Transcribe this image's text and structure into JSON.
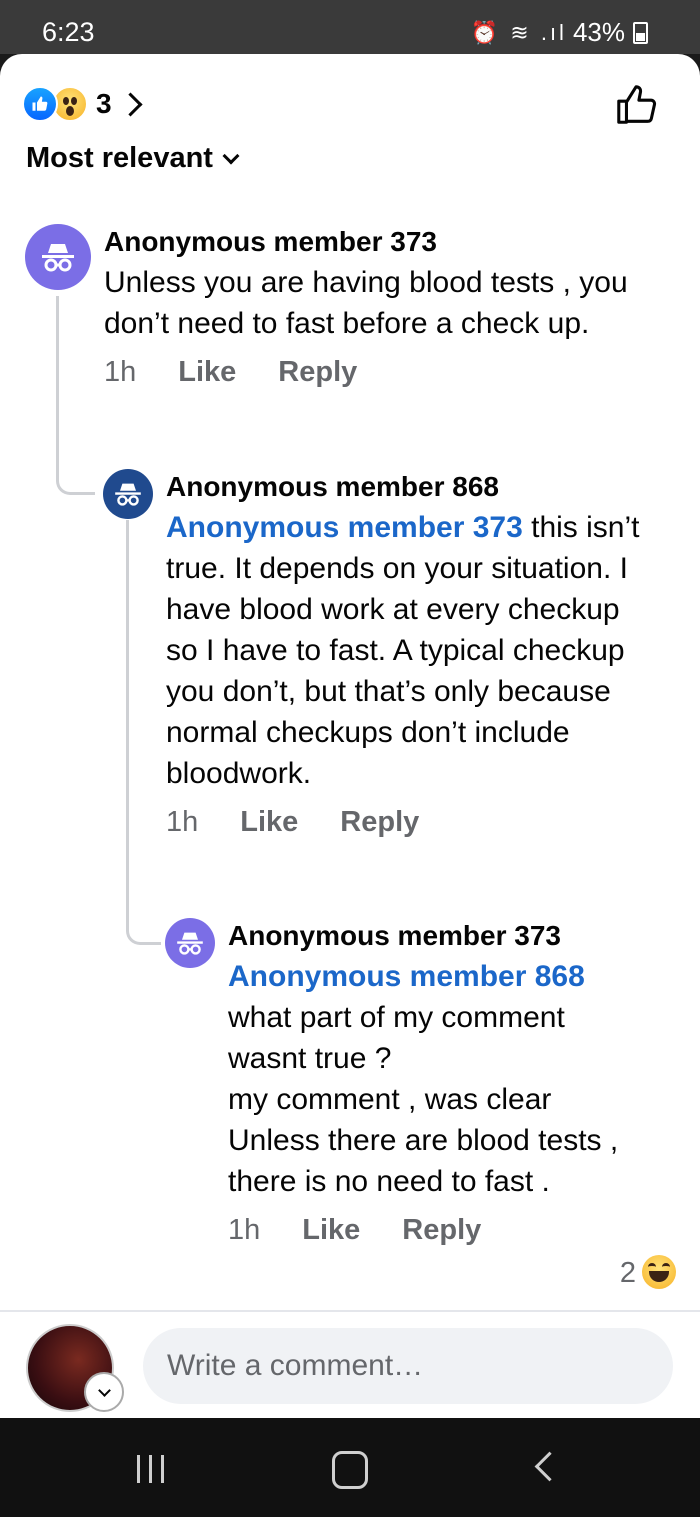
{
  "status_bar": {
    "time": "6:23",
    "icons": "⏰ ≋ .ıl",
    "battery": "43%"
  },
  "reactions": {
    "count": "3"
  },
  "sort": {
    "label": "Most relevant"
  },
  "comments": [
    {
      "author": "Anonymous member 373",
      "mention": "",
      "text": "Unless you are having blood tests , you don’t need to fast before a check up.",
      "time": "1h",
      "like": "Like",
      "reply": "Reply"
    },
    {
      "author": "Anonymous member 868",
      "mention": "Anonymous member 373",
      "text": " this isn’t true. It depends on your situation. I have blood work at every checkup so I have to fast. A typical checkup you don’t, but that’s only because normal checkups don’t include bloodwork.",
      "time": "1h",
      "like": "Like",
      "reply": "Reply"
    },
    {
      "author": "Anonymous member 373",
      "mention": "Anonymous member 868",
      "lines": [
        "what part of my comment wasnt true ?",
        "my comment , was clear",
        "Unless there are blood tests , there is no need to fast ."
      ],
      "time": "1h",
      "like": "Like",
      "reply": "Reply",
      "reaction_count": "2"
    }
  ],
  "composer": {
    "placeholder": "Write a comment…"
  },
  "colors": {
    "brand_blue": "#0866ff",
    "mention": "#1b67c9",
    "avatar_purple": "#7b6ee6",
    "avatar_navy": "#204a8e"
  }
}
